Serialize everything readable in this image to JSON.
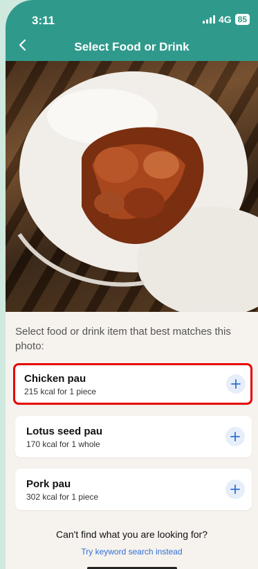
{
  "status_bar": {
    "time": "3:11",
    "network": "4G",
    "battery": "85"
  },
  "header": {
    "title": "Select Food or Drink"
  },
  "prompt": "Select food or drink item that best matches this photo:",
  "items": [
    {
      "name": "Chicken pau",
      "kcal": "215 kcal for 1 piece"
    },
    {
      "name": "Lotus seed pau",
      "kcal": "170 kcal for 1 whole"
    },
    {
      "name": "Pork pau",
      "kcal": "302 kcal for 1 piece"
    }
  ],
  "footer": {
    "cant_find": "Can't find what you are looking for?",
    "keyword_link": "Try keyword search instead"
  },
  "colors": {
    "header": "#2f9a8c",
    "highlight": "#e60000",
    "link": "#2f6fd6"
  },
  "icons": {
    "back": "chevron-left-icon",
    "add": "plus-icon"
  }
}
